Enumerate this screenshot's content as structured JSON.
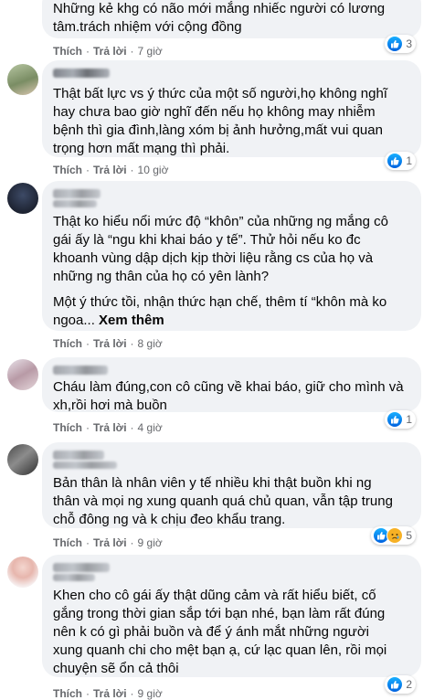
{
  "actions": {
    "like": "Thích",
    "reply": "Trả lời",
    "sep": "·"
  },
  "comments": [
    {
      "paragraphs": [
        "Những kẻ khg có não mới mắng nhiếc người có lương\ntâm.trách nhiệm với cộng đồng"
      ],
      "time": "7 giờ",
      "reactions": [
        "like-icon"
      ],
      "reaction_count": "3"
    },
    {
      "paragraphs": [
        "Thật bất lực vs ý thức của một số người,họ không nghĩ\nhay chưa bao giờ nghĩ đến nếu họ không may nhiễm\nbệnh thì gia đình,làng xóm bị ảnh hưởng,mất vui quan\ntrọng hơn mất mạng thì phải."
      ],
      "time": "10 giờ",
      "reactions": [
        "like-icon"
      ],
      "reaction_count": "1"
    },
    {
      "paragraphs": [
        "Thật ko hiểu nổi mức độ “khôn” của những ng mắng cô\ngái ấy là “ngu khi khai báo y tế”. Thử hỏi nếu ko đc\nkhoanh vùng dập dịch kịp thời liệu rằng cs của họ và\nnhững ng thân của họ có yên lành?",
        "Một ý thức tồi, nhận thức hạn chế, thêm tí “khôn mà ko\nngoa..."
      ],
      "see_more": "Xem thêm",
      "time": "8 giờ"
    },
    {
      "paragraphs": [
        "Cháu làm đúng,con cô cũng về khai báo, giữ cho mình và\nxh,rồi hơi mà buồn"
      ],
      "time": "4 giờ",
      "reactions": [
        "like-icon"
      ],
      "reaction_count": "1"
    },
    {
      "paragraphs": [
        "Bản thân là nhân viên y tế nhiều khi thật buồn khi ng\nthân và mọi ng xung quanh quá chủ quan, vẫn tập trung\nchỗ đông ng và k chịu đeo khẩu trang."
      ],
      "time": "9 giờ",
      "reactions": [
        "like-icon",
        "sad-icon"
      ],
      "reaction_count": "5"
    },
    {
      "paragraphs": [
        "Khen cho cô gái ấy thật dũng cảm và rất hiểu biết, cố\ngắng trong thời gian sắp tới bạn nhé, bạn làm rất đúng\nnên k có gì phải buồn và để ý ánh mắt những người\nxung quanh chi cho mệt bạn ạ, cứ lạc quan lên, rồi mọi\nchuyện sẽ ổn cả thôi"
      ],
      "time": "9 giờ",
      "reactions": [
        "like-icon"
      ],
      "reaction_count": "2"
    }
  ]
}
